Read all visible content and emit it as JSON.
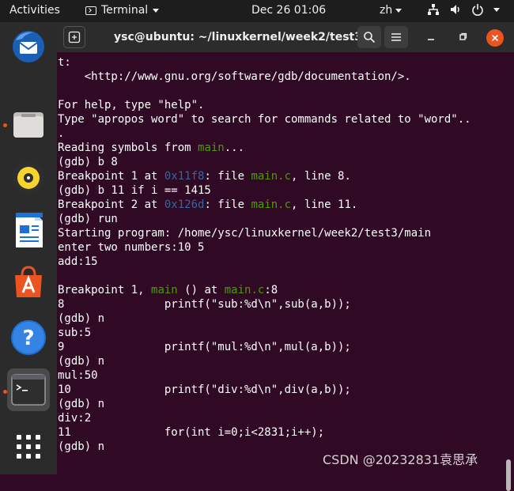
{
  "topbar": {
    "activities": "Activities",
    "app": "Terminal",
    "clock": "Dec 26  01:06",
    "lang": "zh"
  },
  "dock": {
    "items": [
      "thunderbird-icon",
      "files-icon",
      "rhythmbox-icon",
      "writer-icon",
      "software-icon",
      "help-icon",
      "terminal-icon",
      "apps-grid-icon"
    ]
  },
  "window": {
    "title": "ysc@ubuntu: ~/linuxkernel/week2/test3"
  },
  "terminal": {
    "l1": "t:",
    "l2": "    <http://www.gnu.org/software/gdb/documentation/>.",
    "l3": "",
    "l4": "For help, type \"help\".",
    "l5": "Type \"apropos word\" to search for commands related to \"word\"..",
    "l6": ".",
    "l7a": "Reading symbols from ",
    "l7b": "main",
    "l7c": "...",
    "l8": "(gdb) b 8",
    "l9a": "Breakpoint 1 at ",
    "l9b": "0x11f8",
    "l9c": ": file ",
    "l9d": "main.c",
    "l9e": ", line 8.",
    "l10": "(gdb) b 11 if i == 1415",
    "l11a": "Breakpoint 2 at ",
    "l11b": "0x126d",
    "l11c": ": file ",
    "l11d": "main.c",
    "l11e": ", line 11.",
    "l12": "(gdb) run",
    "l13": "Starting program: /home/ysc/linuxkernel/week2/test3/main",
    "l14": "enter two numbers:10 5",
    "l15": "add:15",
    "l16": "",
    "l17a": "Breakpoint 1, ",
    "l17b": "main",
    "l17c": " () at ",
    "l17d": "main.c",
    "l17e": ":8",
    "l18": "8               printf(\"sub:%d\\n\",sub(a,b));",
    "l19": "(gdb) n",
    "l20": "sub:5",
    "l21": "9               printf(\"mul:%d\\n\",mul(a,b));",
    "l22": "(gdb) n",
    "l23": "mul:50",
    "l24": "10              printf(\"div:%d\\n\",div(a,b));",
    "l25": "(gdb) n",
    "l26": "div:2",
    "l27": "11              for(int i=0;i<2831;i++);",
    "l28": "(gdb) n"
  },
  "watermark": "CSDN @20232831袁思承",
  "colors": {
    "terminal_bg": "#300a24",
    "accent": "#e95420",
    "green": "#4e9a06",
    "blue": "#3465a4"
  }
}
